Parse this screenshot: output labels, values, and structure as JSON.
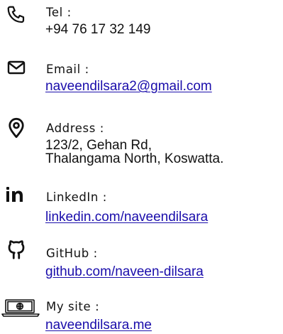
{
  "contacts": [
    {
      "icon": "phone-icon",
      "label": "Tel :",
      "value": "+94 76 17 32 149"
    },
    {
      "icon": "mail-icon",
      "label": "Email :",
      "value": "naveendilsara2@gmail.com"
    },
    {
      "icon": "location-pin-icon",
      "label": "Address :",
      "value_lines": [
        "123/2, Gehan Rd,",
        "Thalangama North, Koswatta."
      ]
    },
    {
      "icon": "linkedin-icon",
      "label": "LinkedIn :",
      "value": "linkedin.com/naveendilsara"
    },
    {
      "icon": "github-icon",
      "label": "GitHub :",
      "value": "github.com/naveen-dilsara"
    },
    {
      "icon": "laptop-globe-icon",
      "label": "My site :",
      "value": "naveendilsara.me"
    }
  ],
  "colors": {
    "text": "#111111",
    "link": "#1a0dab",
    "icon": "#111111"
  }
}
